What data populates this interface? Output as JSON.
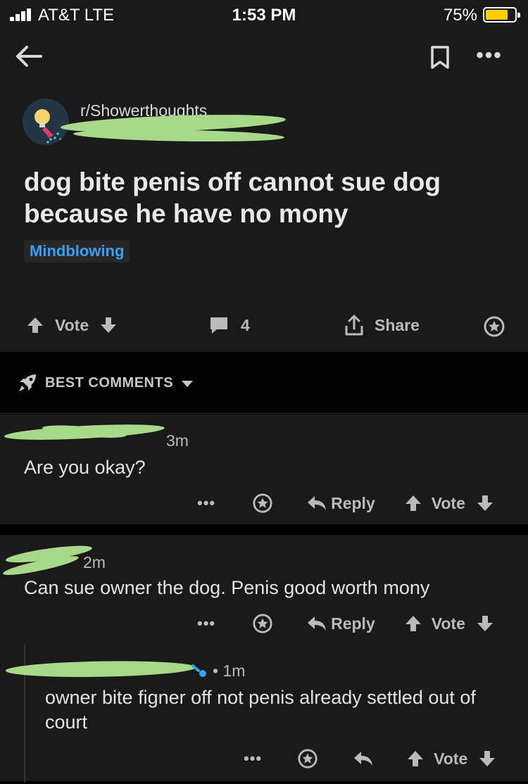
{
  "status_bar": {
    "carrier": "AT&T  LTE",
    "time": "1:53 PM",
    "battery": "75%"
  },
  "nav": {
    "more": "•••"
  },
  "post": {
    "subreddit": "r/Showerthoughts",
    "title": "dog bite penis off cannot sue dog because he have no mony",
    "flair": "Mindblowing",
    "vote_label": "Vote",
    "comment_count": "4",
    "share_label": "Share"
  },
  "sort": {
    "label": "BEST COMMENTS"
  },
  "comments": [
    {
      "age": "3m",
      "text": "Are you okay?",
      "more": "•••",
      "reply_label": "Reply",
      "vote_label": "Vote"
    },
    {
      "age": "2m",
      "text": "Can sue owner the dog. Penis good worth mony",
      "more": "•••",
      "reply_label": "Reply",
      "vote_label": "Vote",
      "replies": [
        {
          "age": "1m",
          "text": "owner bite figner off not penis already settled out of court",
          "more": "•••",
          "vote_label": "Vote"
        }
      ]
    }
  ],
  "colors": {
    "background": "#1a1a1b",
    "accent_flair": "#3aa0f2",
    "redaction": "#a8d98b",
    "battery": "#ffcc00"
  }
}
